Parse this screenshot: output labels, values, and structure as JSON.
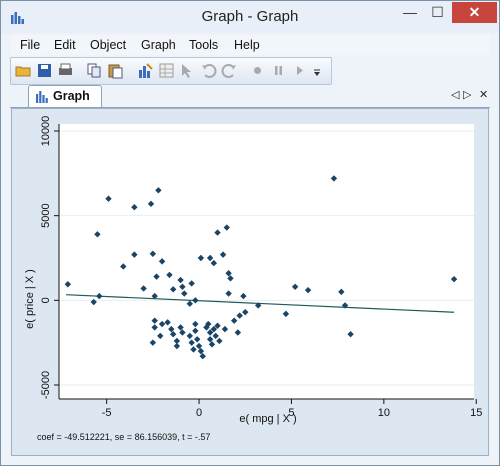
{
  "window": {
    "title": "Graph - Graph",
    "min_glyph": "—",
    "max_glyph": "☐",
    "close_glyph": "✕"
  },
  "menu": {
    "items": [
      "File",
      "Edit",
      "Object",
      "Graph",
      "Tools",
      "Help"
    ]
  },
  "toolbar": {
    "icons": [
      "open-icon",
      "save-icon",
      "print-icon",
      "copy-icon",
      "paste-icon",
      "graph-editor-icon",
      "data-editor-icon",
      "pointer-icon",
      "undo-icon",
      "redo-icon",
      "record-icon",
      "pause-icon",
      "play-icon",
      "overflow-icon"
    ]
  },
  "tab": {
    "label": "Graph",
    "prev_glyph": "◁",
    "next_glyph": "▷",
    "close_glyph": "✕"
  },
  "colors": {
    "marker": "#1a4566",
    "fit_line": "#1f5a57",
    "plot_bg": "#ffffff",
    "graph_bg": "#dce7f1"
  },
  "chart_data": {
    "type": "scatter",
    "xlabel": "e( mpg | X )",
    "ylabel": "e( price | X )",
    "x_ticks": [
      -5,
      0,
      5,
      10,
      15
    ],
    "y_ticks": [
      -5000,
      0,
      5000,
      10000
    ],
    "xlim": [
      -7.2,
      14.5
    ],
    "ylim": [
      -5000,
      10000
    ],
    "grid": true,
    "note": "coef = -49.512221, se = 86.156039, t = -.57",
    "fit_line": {
      "intercept": -22,
      "slope": -49.512221
    },
    "points": [
      [
        -7.1,
        950
      ],
      [
        -5.7,
        -100
      ],
      [
        -5.5,
        3900
      ],
      [
        -5.4,
        250
      ],
      [
        -4.9,
        6000
      ],
      [
        -4.1,
        2000
      ],
      [
        -3.5,
        5500
      ],
      [
        -3.5,
        2700
      ],
      [
        -3.0,
        700
      ],
      [
        -2.6,
        5700
      ],
      [
        -2.5,
        2750
      ],
      [
        -2.4,
        250
      ],
      [
        -2.2,
        6500
      ],
      [
        -2.3,
        1400
      ],
      [
        -2.0,
        2300
      ],
      [
        -1.6,
        1500
      ],
      [
        -1.4,
        650
      ],
      [
        -2.4,
        -1200
      ],
      [
        -2.4,
        -1600
      ],
      [
        -2.1,
        -2100
      ],
      [
        -2.5,
        -2500
      ],
      [
        -2.0,
        -1400
      ],
      [
        -1.7,
        -1300
      ],
      [
        -1.5,
        -1700
      ],
      [
        -1.4,
        -2000
      ],
      [
        -1.2,
        -2400
      ],
      [
        -1.2,
        -2700
      ],
      [
        -1.0,
        1200
      ],
      [
        -0.9,
        800
      ],
      [
        -0.8,
        400
      ],
      [
        -1.0,
        -1600
      ],
      [
        -0.9,
        -1900
      ],
      [
        -0.5,
        -2100
      ],
      [
        -0.4,
        -2500
      ],
      [
        -0.3,
        -2900
      ],
      [
        -0.2,
        -1400
      ],
      [
        -0.2,
        -1800
      ],
      [
        -0.1,
        -2300
      ],
      [
        0.0,
        -2700
      ],
      [
        0.1,
        -3000
      ],
      [
        0.2,
        -3300
      ],
      [
        0.1,
        2500
      ],
      [
        -0.4,
        1000
      ],
      [
        -0.5,
        -200
      ],
      [
        -0.2,
        0
      ],
      [
        0.4,
        -1600
      ],
      [
        0.6,
        -1900
      ],
      [
        0.6,
        -2300
      ],
      [
        0.5,
        -1400
      ],
      [
        0.8,
        -1700
      ],
      [
        0.9,
        -2100
      ],
      [
        0.7,
        -2600
      ],
      [
        1.0,
        -1500
      ],
      [
        1.1,
        -2400
      ],
      [
        1.4,
        -1700
      ],
      [
        0.6,
        2500
      ],
      [
        0.8,
        2200
      ],
      [
        1.0,
        4000
      ],
      [
        1.5,
        4300
      ],
      [
        1.3,
        2700
      ],
      [
        1.6,
        1600
      ],
      [
        1.7,
        1300
      ],
      [
        1.6,
        400
      ],
      [
        1.9,
        -1200
      ],
      [
        2.1,
        -1900
      ],
      [
        2.2,
        -900
      ],
      [
        2.5,
        -700
      ],
      [
        2.4,
        250
      ],
      [
        3.2,
        -300
      ],
      [
        4.7,
        -800
      ],
      [
        5.2,
        800
      ],
      [
        5.9,
        600
      ],
      [
        7.3,
        7200
      ],
      [
        7.7,
        500
      ],
      [
        7.9,
        -300
      ],
      [
        8.2,
        -2000
      ],
      [
        13.8,
        1250
      ]
    ]
  }
}
